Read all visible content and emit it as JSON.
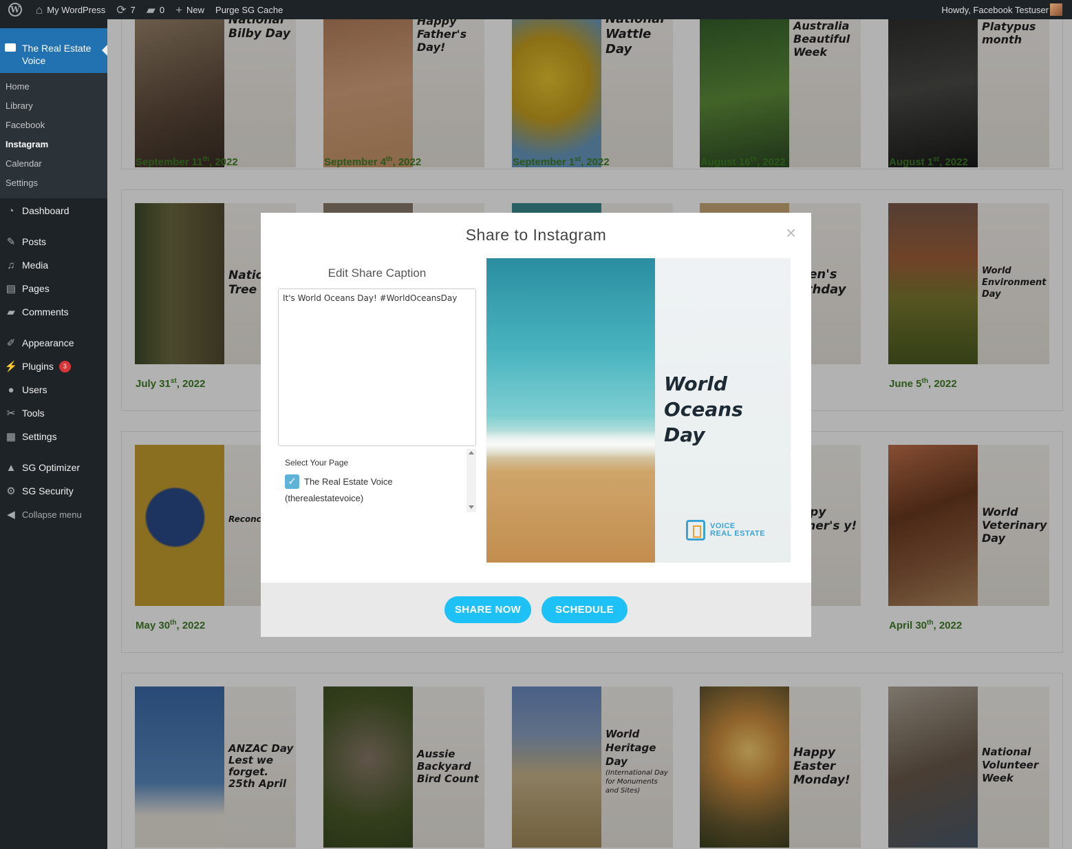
{
  "admin_bar": {
    "site_name": "My WordPress",
    "updates_count": "7",
    "comments_count": "0",
    "new_label": "New",
    "purge_label": "Purge SG Cache",
    "howdy": "Howdy, Facebook Testuser"
  },
  "sidebar": {
    "current_plugin": "The Real Estate Voice",
    "submenu": [
      "Home",
      "Library",
      "Facebook",
      "Instagram",
      "Calendar",
      "Settings"
    ],
    "active_submenu": "Instagram",
    "menu": [
      {
        "label": "Dashboard",
        "icon": "dashboard-icon"
      },
      {
        "label": "Posts",
        "icon": "pin-icon"
      },
      {
        "label": "Media",
        "icon": "media-icon"
      },
      {
        "label": "Pages",
        "icon": "pages-icon"
      },
      {
        "label": "Comments",
        "icon": "comment-icon"
      },
      {
        "label": "Appearance",
        "icon": "brush-icon"
      },
      {
        "label": "Plugins",
        "icon": "plugin-icon",
        "badge": "3"
      },
      {
        "label": "Users",
        "icon": "user-icon"
      },
      {
        "label": "Tools",
        "icon": "wrench-icon"
      },
      {
        "label": "Settings",
        "icon": "settings-icon"
      },
      {
        "label": "SG Optimizer",
        "icon": "optimizer-icon"
      },
      {
        "label": "SG Security",
        "icon": "security-icon"
      },
      {
        "label": "Collapse menu",
        "icon": "collapse-icon"
      }
    ]
  },
  "cards": {
    "row1": [
      {
        "title": "National Bilby Day",
        "date": "September 11",
        "sup": "th",
        "year": ", 2022"
      },
      {
        "title": "Happy Father's Day!",
        "date": "September 4",
        "sup": "th",
        "year": ", 2022"
      },
      {
        "title": "National Wattle Day",
        "date": "September 1",
        "sup": "st",
        "year": ", 2022"
      },
      {
        "title": "Keep Australia Beautiful Week",
        "date": "August 16",
        "sup": "th",
        "year": ", 2022"
      },
      {
        "title": "Platypus month",
        "date": "August 1",
        "sup": "st",
        "year": ", 2022"
      }
    ],
    "row2": [
      {
        "title": "Natio Tree",
        "date": "July 31",
        "sup": "st",
        "year": ", 2022"
      },
      {
        "title": "",
        "date": "",
        "sup": "",
        "year": ""
      },
      {
        "title": "",
        "date": "",
        "sup": "",
        "year": ""
      },
      {
        "title": "een's rthday",
        "date": "",
        "sup": "",
        "year": ""
      },
      {
        "title": "World Environment Day",
        "date": "June 5",
        "sup": "th",
        "year": ", 2022"
      }
    ],
    "row3": [
      {
        "title": "Reconci Day",
        "date": "May 30",
        "sup": "th",
        "year": ", 2022"
      },
      {
        "title": "",
        "date": "",
        "sup": "",
        "year": ""
      },
      {
        "title": "",
        "date": "",
        "sup": "",
        "year": ""
      },
      {
        "title": "ppy ther's y!",
        "date": "",
        "sup": "",
        "year": ""
      },
      {
        "title": "World Veterinary Day",
        "date": "April 30",
        "sup": "th",
        "year": ", 2022"
      }
    ],
    "row4": [
      {
        "title": "ANZAC Day Lest we forget. 25th April"
      },
      {
        "title": "Aussie Backyard Bird Count"
      },
      {
        "title": "World Heritage Day",
        "subtitle": "(International Day for Monuments and Sites)"
      },
      {
        "title": "Happy Easter Monday!"
      },
      {
        "title": "National Volunteer Week"
      }
    ]
  },
  "modal": {
    "title": "Share to Instagram",
    "close": "×",
    "caption_heading": "Edit Share Caption",
    "caption_text": "It's World Oceans Day! #WorldOceansDay",
    "select_page_label": "Select Your Page",
    "page_name": "The Real Estate Voice",
    "page_handle": "(therealestatevoice)",
    "preview_title_lines": [
      "World",
      "Oceans",
      "Day"
    ],
    "preview_logo_lines": [
      "VOICE",
      "REAL ESTATE"
    ],
    "share_now": "SHARE NOW",
    "schedule": "SCHEDULE"
  },
  "colors": {
    "accent_button": "#1ec1f5",
    "date_green": "#3f7d26",
    "sidebar_active": "#2271b1"
  }
}
